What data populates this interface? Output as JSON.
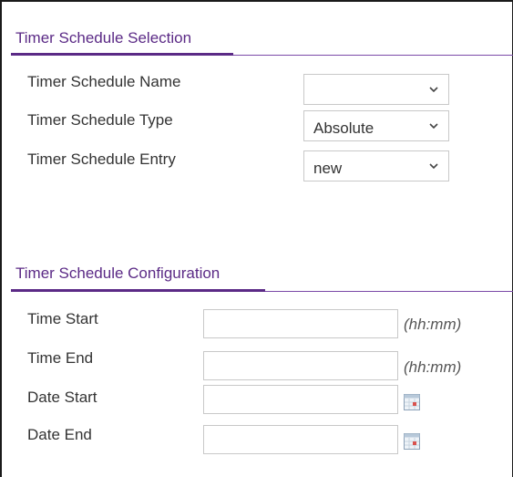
{
  "selection": {
    "title": "Timer Schedule Selection",
    "rows": [
      {
        "label": "Timer Schedule Name",
        "value": ""
      },
      {
        "label": "Timer Schedule Type",
        "value": "Absolute"
      },
      {
        "label": "Timer Schedule Entry",
        "value": "new"
      }
    ]
  },
  "configuration": {
    "title": "Timer Schedule Configuration",
    "rows": [
      {
        "label": "Time Start",
        "value": "",
        "hint": "(hh:mm)"
      },
      {
        "label": "Time End",
        "value": "",
        "hint": "(hh:mm)"
      },
      {
        "label": "Date Start",
        "value": "",
        "icon": "calendar-icon"
      },
      {
        "label": "Date End",
        "value": "",
        "icon": "calendar-icon"
      }
    ]
  },
  "colors": {
    "accent": "#5b2a86",
    "border": "#c8c8c8",
    "text": "#333333"
  }
}
